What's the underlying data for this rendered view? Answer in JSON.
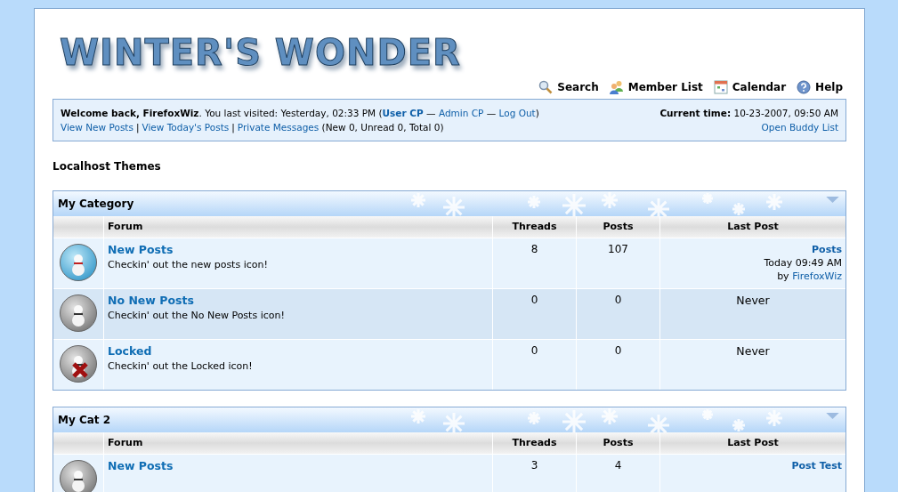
{
  "logo": {
    "text": "WINTER'S WONDER"
  },
  "nav": [
    {
      "label": "Search"
    },
    {
      "label": "Member List"
    },
    {
      "label": "Calendar"
    },
    {
      "label": "Help"
    }
  ],
  "welcome": {
    "greeting": "Welcome back, FirefoxWiz",
    "last_visit": ". You last visited: Yesterday, 02:33 PM (",
    "user_cp": "User CP",
    "sep1": " — ",
    "admin_cp": "Admin CP",
    "sep2": " — ",
    "logout": "Log Out",
    "close": ")",
    "link_separator": "|",
    "links": [
      "View New Posts",
      "View Today's Posts",
      "Private Messages"
    ],
    "pm_counts": "(New 0, Unread 0, Total 0)",
    "time_label": "Current time:",
    "time_value": "10-23-2007, 09:50 AM",
    "buddy": "Open Buddy List"
  },
  "board_title": "Localhost Themes",
  "categories": [
    {
      "name": "My Category",
      "columns": [
        "Forum",
        "Threads",
        "Posts",
        "Last Post"
      ],
      "forums": [
        {
          "kind": "new",
          "name": "New Posts",
          "description": "Checkin' out the new posts icon!",
          "threads": "8",
          "posts": "107",
          "last_post": {
            "kind": "post",
            "title": "Posts",
            "time": "Today 09:49 AM",
            "by": "by",
            "user": "FirefoxWiz"
          }
        },
        {
          "kind": "no_new",
          "name": "No New Posts",
          "description": "Checkin' out the No New Posts icon!",
          "threads": "0",
          "posts": "0",
          "last_post": {
            "kind": "never",
            "text": "Never"
          }
        },
        {
          "kind": "locked",
          "name": "Locked",
          "description": "Checkin' out the Locked icon!",
          "threads": "0",
          "posts": "0",
          "last_post": {
            "kind": "never",
            "text": "Never"
          }
        }
      ]
    },
    {
      "name": "My Cat 2",
      "columns": [
        "Forum",
        "Threads",
        "Posts",
        "Last Post"
      ],
      "forums": [
        {
          "kind": "no_new",
          "name": "New Posts",
          "threads": "3",
          "posts": "4",
          "last_post": {
            "kind": "title",
            "title": "Post Test"
          }
        }
      ]
    }
  ]
}
